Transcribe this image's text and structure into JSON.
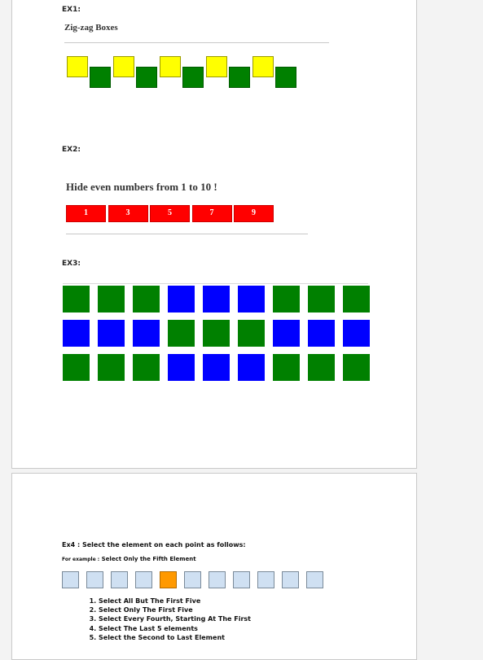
{
  "ex1": {
    "label": "EX1:",
    "title": "Zig-zag Boxes",
    "boxes": [
      "yellow",
      "green",
      "yellow",
      "green",
      "yellow",
      "green",
      "yellow",
      "green",
      "yellow",
      "green"
    ]
  },
  "ex2": {
    "label": "EX2:",
    "title": "Hide even numbers from 1 to 10 !",
    "numbers": [
      "1",
      "3",
      "5",
      "7",
      "9"
    ]
  },
  "ex3": {
    "label": "EX3:",
    "grid": [
      [
        "green",
        "green",
        "green",
        "blue",
        "blue",
        "blue",
        "green",
        "green",
        "green"
      ],
      [
        "blue",
        "blue",
        "blue",
        "green",
        "green",
        "green",
        "blue",
        "blue",
        "blue"
      ],
      [
        "green",
        "green",
        "green",
        "blue",
        "blue",
        "blue",
        "green",
        "green",
        "green"
      ]
    ]
  },
  "ex4": {
    "title": "Ex4 : Select the element on each point as follows:",
    "example_prefix": "For example :",
    "example_text": "Select  Only the Fifth Element",
    "box_count": 11,
    "active_index": 4,
    "tasks": [
      "Select All But The First Five",
      "Select Only The First Five",
      "Select Every Fourth, Starting At The First",
      "Select The Last 5 elements",
      "Select the Second to Last Element"
    ]
  },
  "colors": {
    "yellow": "#ffff00",
    "green": "#008000",
    "blue": "#0000ff",
    "red": "#ff0000",
    "orange": "#ff9900",
    "light_blue": "#cfe0f2"
  }
}
